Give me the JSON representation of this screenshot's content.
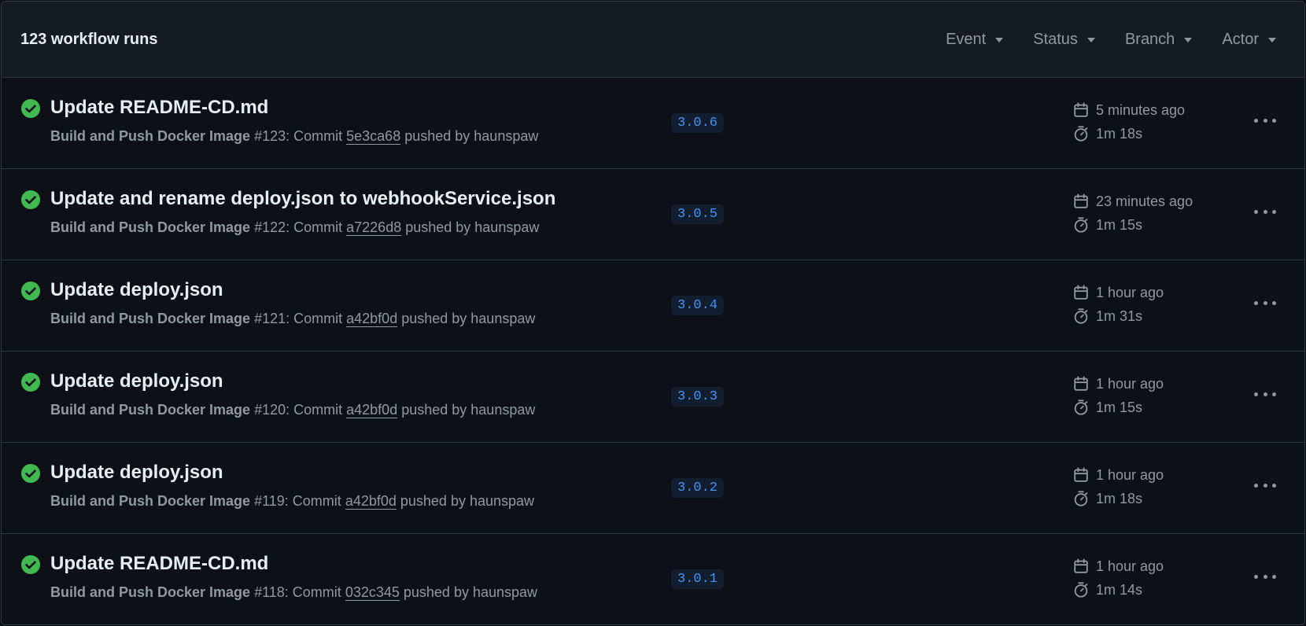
{
  "header": {
    "run_count": "123 workflow runs",
    "filters": {
      "event": "Event",
      "status": "Status",
      "branch": "Branch",
      "actor": "Actor"
    }
  },
  "runs": [
    {
      "title": "Update README-CD.md",
      "workflow": "Build and Push Docker Image",
      "run_number": "#123",
      "commit_prefix": ": Commit ",
      "sha": "5e3ca68",
      "pushed_by": " pushed by haunspaw",
      "branch": "3.0.6",
      "time_ago": "5 minutes ago",
      "duration": "1m 18s",
      "status": "success"
    },
    {
      "title": "Update and rename deploy.json to webhookService.json",
      "workflow": "Build and Push Docker Image",
      "run_number": "#122",
      "commit_prefix": ": Commit ",
      "sha": "a7226d8",
      "pushed_by": " pushed by haunspaw",
      "branch": "3.0.5",
      "time_ago": "23 minutes ago",
      "duration": "1m 15s",
      "status": "success"
    },
    {
      "title": "Update deploy.json",
      "workflow": "Build and Push Docker Image",
      "run_number": "#121",
      "commit_prefix": ": Commit ",
      "sha": "a42bf0d",
      "pushed_by": " pushed by haunspaw",
      "branch": "3.0.4",
      "time_ago": "1 hour ago",
      "duration": "1m 31s",
      "status": "success"
    },
    {
      "title": "Update deploy.json",
      "workflow": "Build and Push Docker Image",
      "run_number": "#120",
      "commit_prefix": ": Commit ",
      "sha": "a42bf0d",
      "pushed_by": " pushed by haunspaw",
      "branch": "3.0.3",
      "time_ago": "1 hour ago",
      "duration": "1m 15s",
      "status": "success"
    },
    {
      "title": "Update deploy.json",
      "workflow": "Build and Push Docker Image",
      "run_number": "#119",
      "commit_prefix": ": Commit ",
      "sha": "a42bf0d",
      "pushed_by": " pushed by haunspaw",
      "branch": "3.0.2",
      "time_ago": "1 hour ago",
      "duration": "1m 18s",
      "status": "success"
    },
    {
      "title": "Update README-CD.md",
      "workflow": "Build and Push Docker Image",
      "run_number": "#118",
      "commit_prefix": ": Commit ",
      "sha": "032c345",
      "pushed_by": " pushed by haunspaw",
      "branch": "3.0.1",
      "time_ago": "1 hour ago",
      "duration": "1m 14s",
      "status": "success"
    }
  ],
  "icons": {
    "status": "check-circle-fill-icon",
    "calendar": "calendar-icon",
    "stopwatch": "stopwatch-icon",
    "more": "kebab-horizontal-icon",
    "caret": "triangle-down-icon"
  },
  "colors": {
    "success": "#3fb950",
    "branch_text": "#4493f8",
    "branch_bg": "#121d2f",
    "muted_text": "#9198a1",
    "header_bg": "#161b22",
    "page_bg": "#0d1117",
    "border": "#30363d"
  }
}
